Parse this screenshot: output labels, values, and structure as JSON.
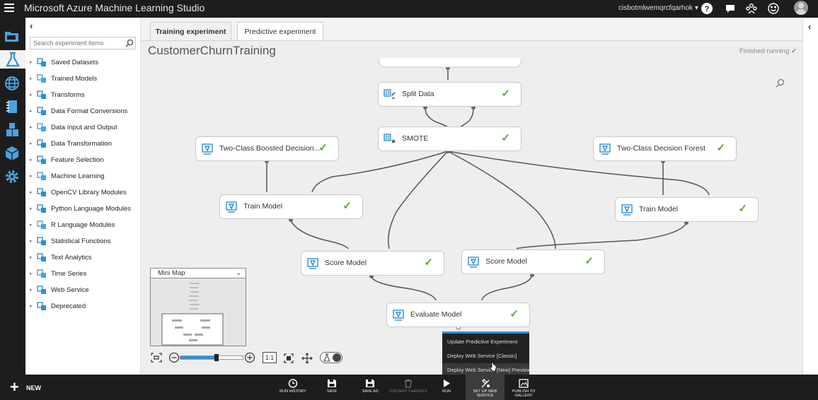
{
  "app": {
    "title": "Microsoft Azure Machine Learning Studio",
    "account": "cisbotmlwemqrcfqarhok ▾"
  },
  "palette": {
    "search_placeholder": "Search experiment items",
    "categories": [
      "Saved Datasets",
      "Trained Models",
      "Transforms",
      "Data Format Conversions",
      "Data Input and Output",
      "Data Transformation",
      "Feature Selection",
      "Machine Learning",
      "OpenCV Library Modules",
      "Python Language Modules",
      "R Language Modules",
      "Statistical Functions",
      "Text Analytics",
      "Time Series",
      "Web Service",
      "Deprecated"
    ]
  },
  "tabs": {
    "training": "Training experiment",
    "predictive": "Predictive experiment"
  },
  "experiment": {
    "title": "CustomerChurnTraining",
    "status": "Finished running",
    "status_mark": "✓"
  },
  "nodes": {
    "split_data": "Split Data",
    "smote": "SMOTE",
    "boosted_tree": "Two-Class Boosted Decision...",
    "decision_forest": "Two-Class Decision Forest",
    "train_model_left": "Train Model",
    "train_model_right": "Train Model",
    "score_model_left": "Score Model",
    "score_model_right": "Score Model",
    "evaluate_model": "Evaluate Model",
    "check": "✓"
  },
  "minimap": {
    "label": "Mini Map"
  },
  "zoom": {
    "actual_size": "1:1",
    "level_percent": 55
  },
  "context_menu": {
    "items": [
      "Update Predictive Experiment",
      "Deploy Web Service [Classic]",
      "Deploy Web Service [New] Preview"
    ]
  },
  "bottombar": {
    "new": "NEW",
    "run_history": "RUN HISTORY",
    "save": "SAVE",
    "save_as": "SAVE AS",
    "discard": "DISCARD CHANGES",
    "run": "RUN",
    "setup_ws_1": "SET UP WEB",
    "setup_ws_2": "SERVICE",
    "publish_1": "PUBLISH TO",
    "publish_2": "GALLERY"
  },
  "colors": {
    "accent": "#2f8fd0",
    "success": "#5aa838",
    "chrome": "#1d1d1d"
  }
}
